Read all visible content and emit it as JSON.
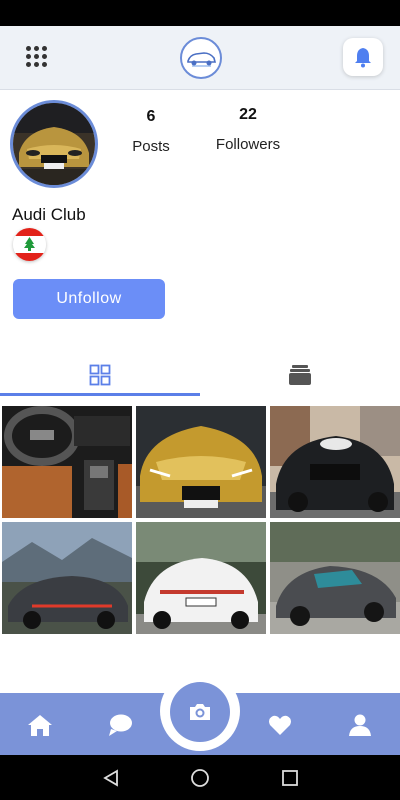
{
  "header": {
    "menu_icon": "grid-menu-icon",
    "logo_icon": "car-logo-icon",
    "notification_icon": "bell-icon",
    "accent_color": "#6b8ef7"
  },
  "profile": {
    "name": "Audi Club",
    "avatar_desc": "gold-audi-car-photo",
    "flag_icon": "lebanon-flag-icon",
    "stats": [
      {
        "value": "6",
        "label": "Posts"
      },
      {
        "value": "22",
        "label": "Followers"
      }
    ],
    "unfollow_label": "Unfollow"
  },
  "tabs": [
    {
      "icon": "grid-view-icon",
      "active": true
    },
    {
      "icon": "stack-view-icon",
      "active": false
    }
  ],
  "gallery": [
    {
      "desc": "audi-interior-photo"
    },
    {
      "desc": "gold-audi-r8-photo"
    },
    {
      "desc": "black-audi-suv-photo"
    },
    {
      "desc": "grey-audi-rs7-photo"
    },
    {
      "desc": "white-audi-a5-photo"
    },
    {
      "desc": "grey-audi-r8-photo"
    }
  ],
  "bottom_nav": [
    {
      "icon": "home-icon"
    },
    {
      "icon": "chat-icon"
    },
    {
      "icon": "camera-icon"
    },
    {
      "icon": "heart-icon"
    },
    {
      "icon": "profile-icon"
    }
  ],
  "system_nav": [
    {
      "icon": "back-icon"
    },
    {
      "icon": "home-circle-icon"
    },
    {
      "icon": "recents-icon"
    }
  ],
  "colors": {
    "nav_bar": "#7b93d8",
    "tab_indicator": "#5b7fe8",
    "button": "#6b8ef7"
  }
}
